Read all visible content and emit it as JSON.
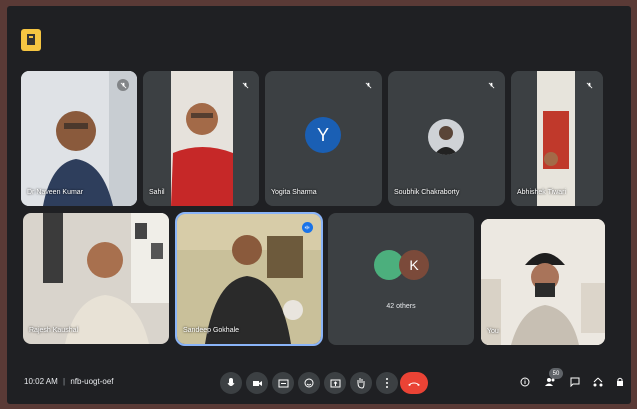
{
  "participants": [
    {
      "name": "Dr Naveen Kumar"
    },
    {
      "name": "Sahil"
    },
    {
      "name": "Yogita Sharma",
      "initial": "Y",
      "color": "#1a5fb4"
    },
    {
      "name": "Soubhik Chakraborty"
    },
    {
      "name": "Abhishek Tiwari"
    },
    {
      "name": "Rajesh Kaushal"
    },
    {
      "name": "Sandeep Gokhale"
    },
    {
      "name": "You"
    }
  ],
  "others": {
    "label": "42 others",
    "initial": "K",
    "color_k": "#7b4a3a",
    "color_a": "#4caf7d"
  },
  "meeting": {
    "time": "10:02 AM",
    "separator": "|",
    "code": "nfb-uogt-oef"
  },
  "people_count": "50",
  "controls": [
    "mic-icon",
    "camera-icon",
    "captions-icon",
    "emoji-icon",
    "present-icon",
    "raise-hand-icon",
    "more-icon",
    "end-call-icon"
  ],
  "right_controls": [
    "info-icon",
    "people-icon",
    "chat-icon",
    "activities-icon",
    "lock-icon"
  ]
}
